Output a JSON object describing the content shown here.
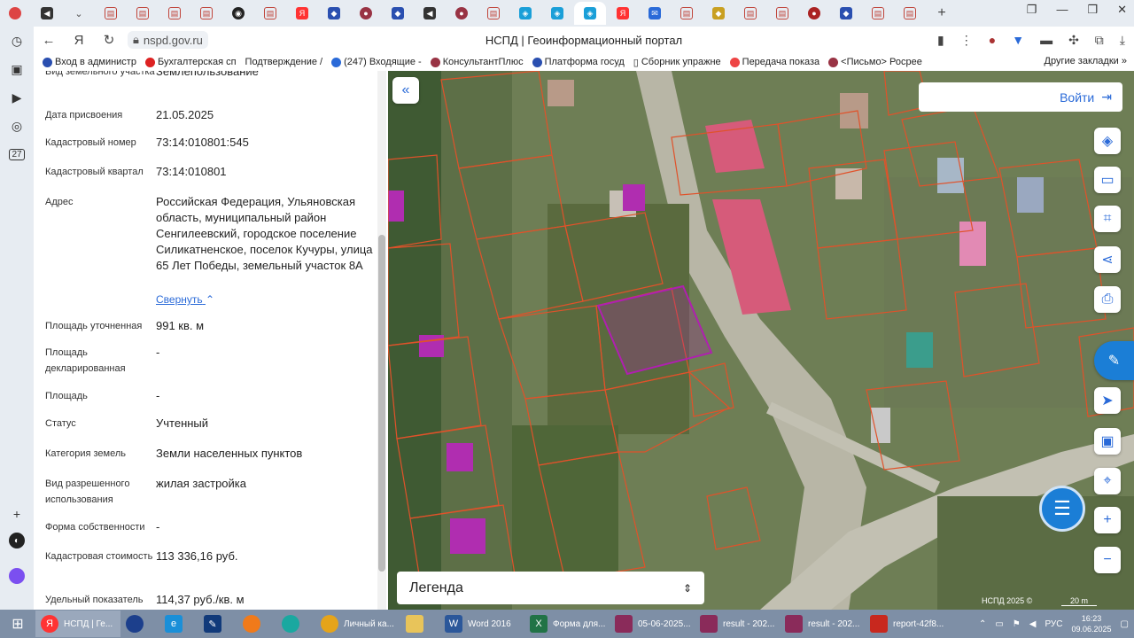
{
  "browser": {
    "url": "nspd.gov.ru",
    "page_title": "НСПД | Геоинформационный портал",
    "bookmarks": [
      "Вход в администр",
      "Бухгалтерская сп",
      "Подтверждение /",
      "(247) Входящие -",
      "КонсультантПлюс",
      "Платформа госуд",
      "Сборник упражне",
      "Передача показа",
      "<Письмо> Росрее"
    ],
    "bookmarks_other": "Другие закладки",
    "sidebar_badge": "27"
  },
  "panel": {
    "fields": [
      {
        "label": "Вид земельного участка",
        "value": "Землепользование"
      },
      {
        "label": "Дата присвоения",
        "value": "21.05.2025"
      },
      {
        "label": "Кадастровый номер",
        "value": "73:14:010801:545"
      },
      {
        "label": "Кадастровый квартал",
        "value": "73:14:010801"
      },
      {
        "label": "Адрес",
        "value": "Российская Федерация, Ульяновская область, муниципальный район Сенгилеевский, городское поселение Силикатненское, поселок Кучуры, улица 65 Лет Победы, земельный участок 8А"
      },
      {
        "label": "Площадь уточненная",
        "value": "991 кв. м"
      },
      {
        "label": "Площадь декларированная",
        "value": "-"
      },
      {
        "label": "Площадь",
        "value": "-"
      },
      {
        "label": "Статус",
        "value": "Учтенный"
      },
      {
        "label": "Категория земель",
        "value": "Земли населенных пунктов"
      },
      {
        "label": "Вид разрешенного использования",
        "value": "жилая застройка"
      },
      {
        "label": "Форма собственности",
        "value": "-"
      },
      {
        "label": "Кадастровая стоимость",
        "value": "113 336,16 руб."
      },
      {
        "label": "Удельный показатель",
        "value": "114,37 руб./кв. м"
      }
    ],
    "collapse_label": "Свернуть"
  },
  "map": {
    "login_label": "Войти",
    "legend_label": "Легенда",
    "copyright": "НСПД 2025 ©",
    "scale": "20 m"
  },
  "taskbar": {
    "items": [
      "НСПД | Ге...",
      "Личный ка...",
      "Word 2016",
      "Форма для...",
      "05-06-2025...",
      "result - 202...",
      "result - 202...",
      "report-42f8..."
    ],
    "lang": "РУС",
    "time": "16:23",
    "date": "09.06.2025"
  },
  "colors": {
    "accent": "#2a6ad8",
    "parcel_line": "#e0522a",
    "selected_parcel": "#b01fb0"
  }
}
